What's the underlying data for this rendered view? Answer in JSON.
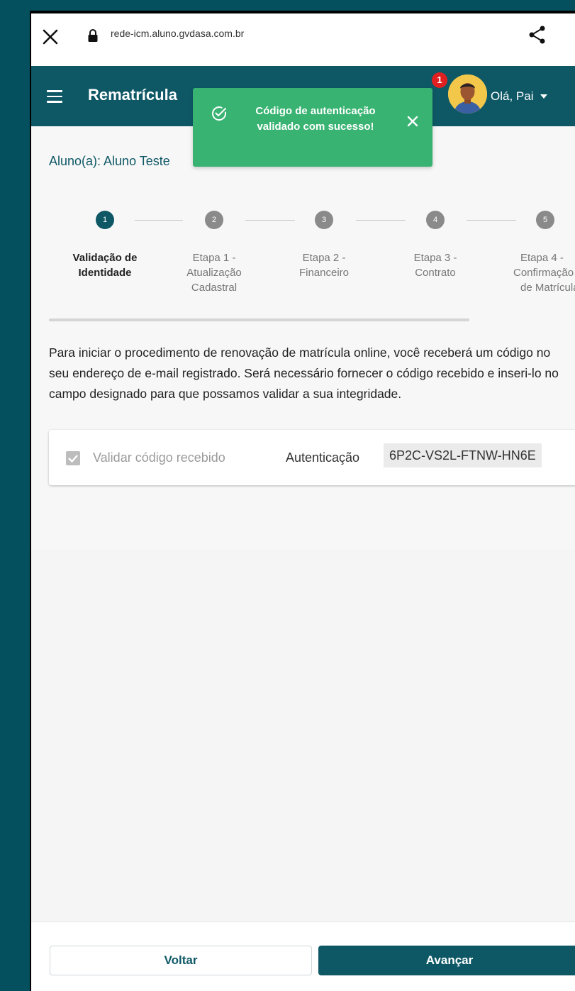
{
  "browser": {
    "url": "rede-icm.aluno.gvdasa.com.br",
    "icons": [
      "close-icon",
      "lock-icon",
      "share-icon"
    ]
  },
  "header": {
    "title": "Rematrícula",
    "notification_count": "1",
    "greeting": "Olá, Pai",
    "brand_color": "#0e5866"
  },
  "toast": {
    "message": "Código de autenticação validado com sucesso!",
    "color": "#38b371"
  },
  "student": {
    "label": "Aluno(a): Aluno Teste"
  },
  "stepper": {
    "steps": [
      {
        "number": "1",
        "line1": "Validação de",
        "line2": "Identidade",
        "line3": ""
      },
      {
        "number": "2",
        "line1": "Etapa 1 -",
        "line2": "Atualização",
        "line3": "Cadastral"
      },
      {
        "number": "3",
        "line1": "Etapa 2 -",
        "line2": "Financeiro",
        "line3": ""
      },
      {
        "number": "4",
        "line1": "Etapa 3 -",
        "line2": "Contrato",
        "line3": ""
      },
      {
        "number": "5",
        "line1": "Etapa 4 -",
        "line2": "Confirmação",
        "line3": "de Matrícula"
      }
    ],
    "active_step": 1
  },
  "intro_text": "Para iniciar o procedimento de renovação de matrícula online, você receberá um código no seu endereço de e-mail registrado. Será necessário fornecer o código recebido e inseri-lo no campo designado para que possamos validar a sua integridade.",
  "validation": {
    "checkbox_label": "Validar código recebido",
    "checked": true,
    "auth_label": "Autenticação",
    "auth_code": "6P2C-VS2L-FTNW-HN6E"
  },
  "footer": {
    "back_label": "Voltar",
    "next_label": "Avançar"
  }
}
